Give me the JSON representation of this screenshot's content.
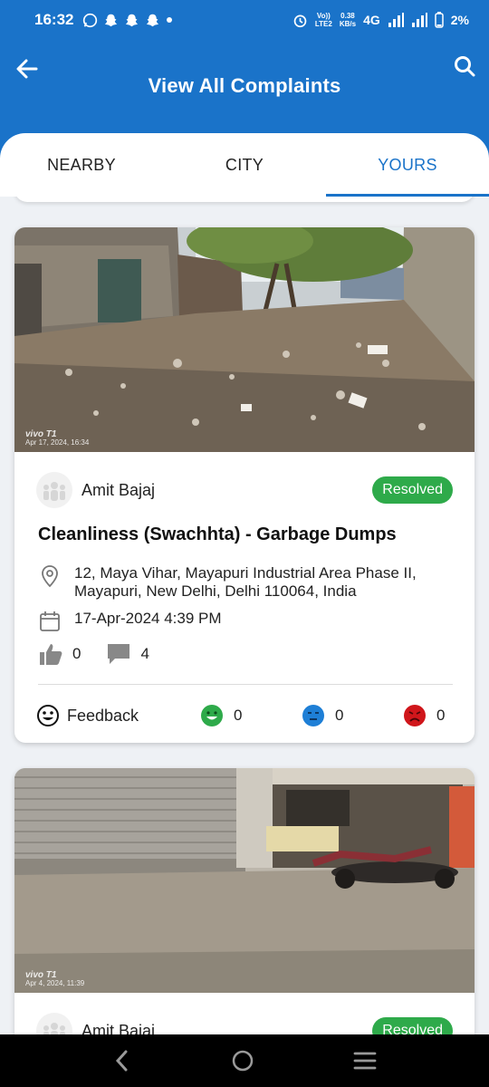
{
  "status_bar": {
    "time": "16:32",
    "network_top": "Vo))",
    "network_bottom": "LTE2",
    "speed_top": "0.38",
    "speed_bottom": "KB/s",
    "network_type": "4G",
    "battery": "2%"
  },
  "header": {
    "title": "View All Complaints",
    "back_icon": "arrow-left-icon",
    "search_icon": "search-icon",
    "accent_color": "#1a73c9"
  },
  "tabs": [
    {
      "label": "NEARBY",
      "active": false
    },
    {
      "label": "CITY",
      "active": false
    },
    {
      "label": "YOURS",
      "active": true
    }
  ],
  "complaints": [
    {
      "user": "Amit Bajaj",
      "status": "Resolved",
      "title": "Cleanliness (Swachhta) - Garbage Dumps",
      "address": "12, Maya Vihar, Mayapuri Industrial Area Phase II, Mayapuri, New Delhi, Delhi 110064, India",
      "date": "17-Apr-2024 4:39 PM",
      "likes": "0",
      "comments": "4",
      "photo_brand": "vivo T1",
      "photo_stamp": "Apr 17, 2024, 16:34",
      "feedback_label": "Feedback",
      "reactions": {
        "happy": "0",
        "neutral": "0",
        "sad": "0"
      }
    },
    {
      "user": "Amit Bajaj",
      "status": "Resolved",
      "photo_brand": "vivo T1",
      "photo_stamp": "Apr 4, 2024, 11:39"
    }
  ],
  "colors": {
    "resolved": "#2eaa4a",
    "happy": "#2eaa4a",
    "neutral": "#1e7fd6",
    "sad": "#d0161b"
  }
}
